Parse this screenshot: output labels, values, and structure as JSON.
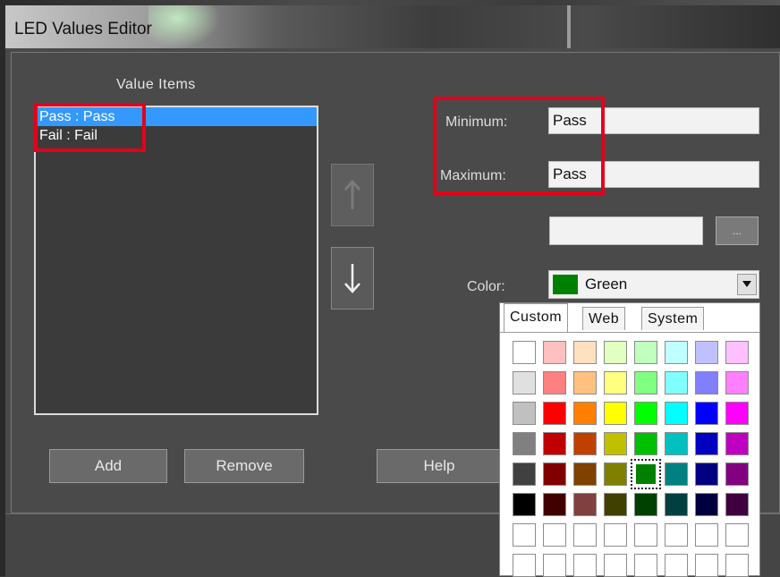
{
  "window": {
    "title": "LED Values Editor"
  },
  "value_items": {
    "label": "Value Items",
    "items": [
      {
        "label": "Pass : Pass",
        "selected": true
      },
      {
        "label": "Fail : Fail",
        "selected": false
      }
    ]
  },
  "move_buttons": {
    "up_icon": "arrow-up-icon",
    "down_icon": "arrow-down-icon",
    "up_enabled": false,
    "down_enabled": true
  },
  "minimum": {
    "label": "Minimum:",
    "value": "Pass"
  },
  "maximum": {
    "label": "Maximum:",
    "value": "Pass"
  },
  "extra_field": {
    "value": ""
  },
  "browse_button": {
    "label": "..."
  },
  "color": {
    "label": "Color:",
    "value": "Green",
    "swatch": "#008000"
  },
  "buttons": {
    "add": "Add",
    "remove": "Remove",
    "help": "Help"
  },
  "color_picker": {
    "tabs": [
      "Custom",
      "Web",
      "System"
    ],
    "active_tab": "Custom",
    "selected": "#008000",
    "rows": [
      [
        "#ffffff",
        "#ffc0c0",
        "#ffe0c0",
        "#e0ffc0",
        "#c0ffc0",
        "#c0ffff",
        "#c0c0ff",
        "#ffc0ff"
      ],
      [
        "#e0e0e0",
        "#ff8080",
        "#ffc080",
        "#ffff80",
        "#80ff80",
        "#80ffff",
        "#8080ff",
        "#ff80ff"
      ],
      [
        "#c0c0c0",
        "#ff0000",
        "#ff8000",
        "#ffff00",
        "#00ff00",
        "#00ffff",
        "#0000ff",
        "#ff00ff"
      ],
      [
        "#808080",
        "#c00000",
        "#c04000",
        "#c0c000",
        "#00c000",
        "#00c0c0",
        "#0000c0",
        "#c000c0"
      ],
      [
        "#404040",
        "#800000",
        "#804000",
        "#808000",
        "#008000",
        "#008080",
        "#000080",
        "#800080"
      ],
      [
        "#000000",
        "#400000",
        "#804040",
        "#404000",
        "#004000",
        "#004040",
        "#000040",
        "#400040"
      ],
      [
        "#ffffff",
        "#ffffff",
        "#ffffff",
        "#ffffff",
        "#ffffff",
        "#ffffff",
        "#ffffff",
        "#ffffff"
      ],
      [
        "#ffffff",
        "#ffffff",
        "#ffffff",
        "#ffffff",
        "#ffffff",
        "#ffffff",
        "#ffffff",
        "#ffffff"
      ]
    ]
  },
  "highlight_color": "#e4001a"
}
